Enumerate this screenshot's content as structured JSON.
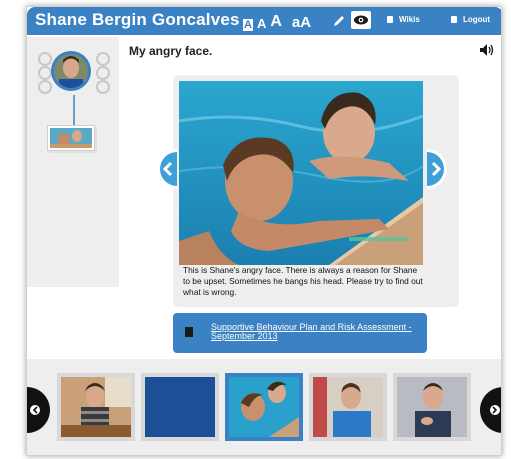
{
  "header": {
    "title": "Shane Bergin Goncalves",
    "text_size_options": [
      "A",
      "A",
      "A",
      "aA"
    ],
    "wikis_label": "Wikis",
    "logout_label": "Logout",
    "bar_color": "#3b82c4"
  },
  "page": {
    "title": "My angry face.",
    "caption": "This is Shane's angry face. There is always a reason for Shane to be upset. Sometimes he bangs his head. Please try to find out what is wrong.",
    "photo_timestamp": "13.08.2013 16:09"
  },
  "document": {
    "link_text": "Supportive Behaviour Plan and Risk Assessment - September 2013"
  },
  "thumbnails": {
    "count": 5,
    "selected_index": 2
  },
  "icons": [
    "pencil-icon",
    "eye-icon",
    "lock-icon",
    "speaker-icon",
    "chevron-left-icon",
    "chevron-right-icon",
    "document-icon"
  ],
  "colors": {
    "accent": "#3b82c4",
    "panel": "#eeeeee",
    "nav_arrow": "#3fa0d8"
  }
}
